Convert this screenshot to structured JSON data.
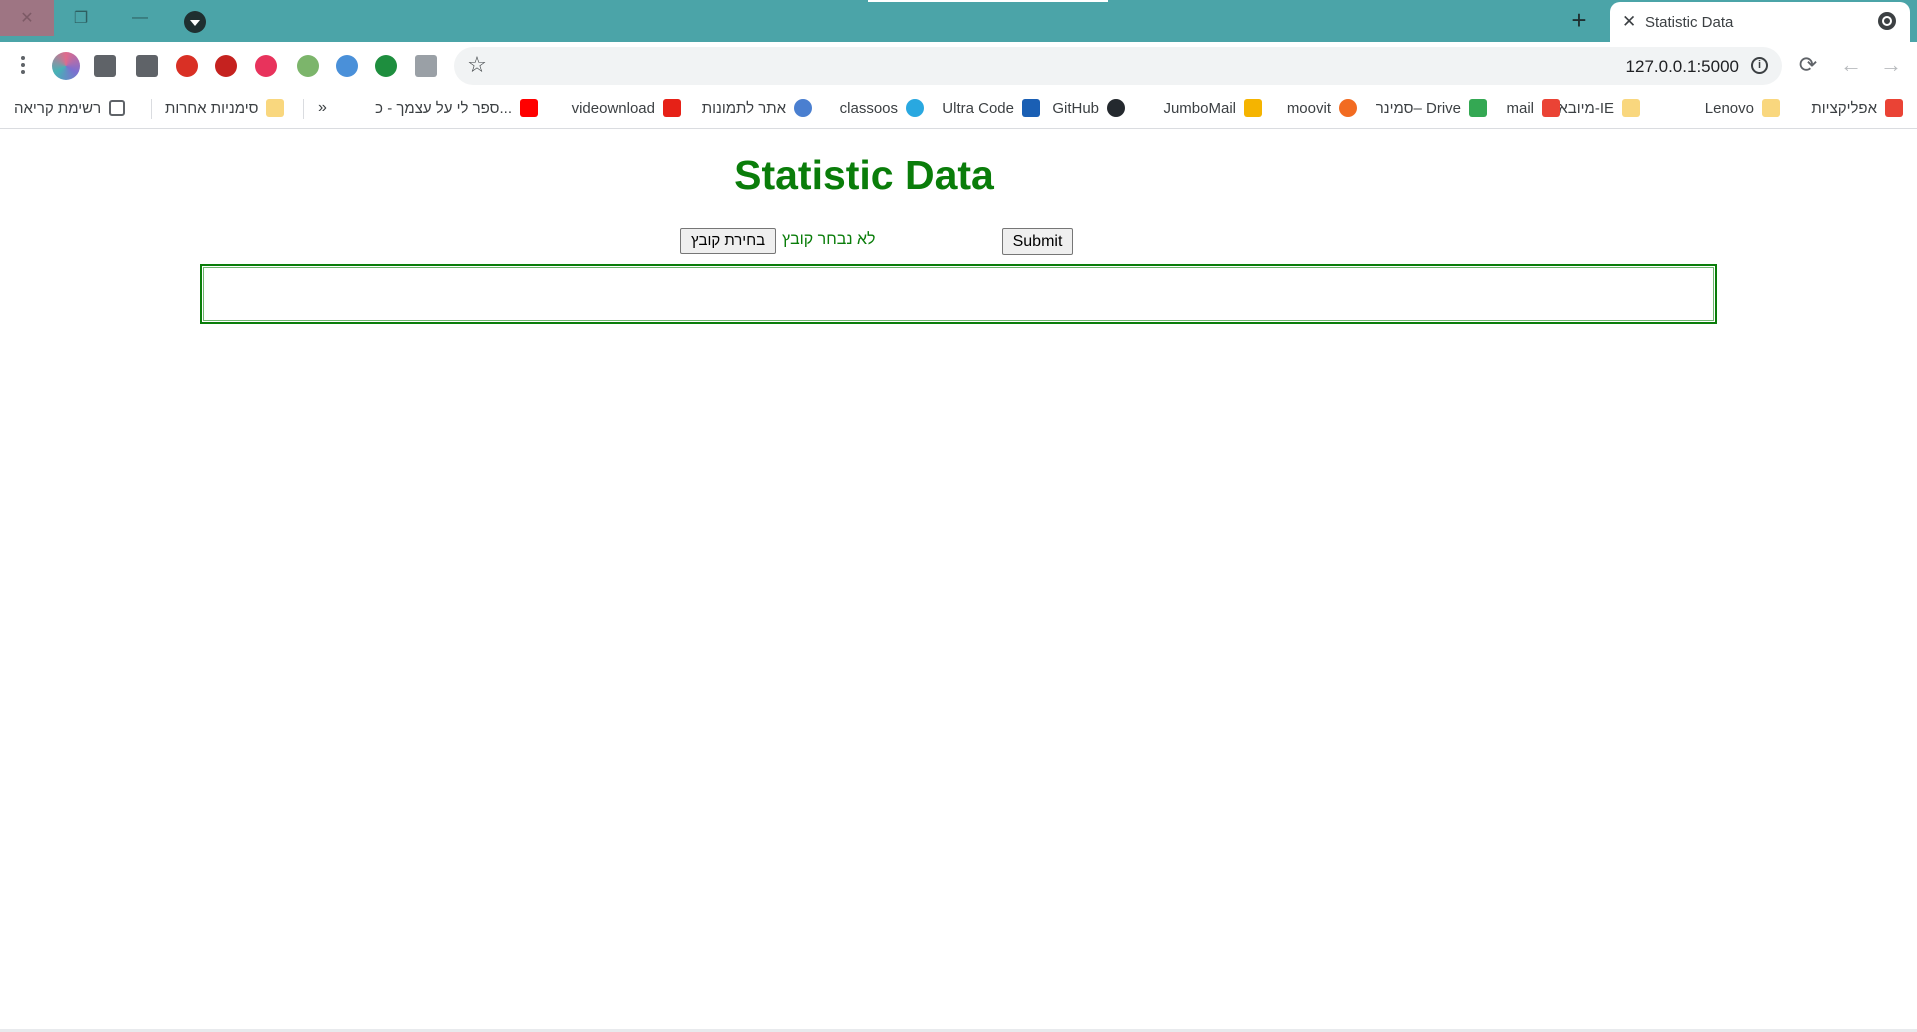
{
  "window": {
    "close_glyph": "✕",
    "restore_glyph": "❐",
    "minimize_glyph": "—"
  },
  "tabs": {
    "new_tab_glyph": "+",
    "active": {
      "title": "Statistic Data",
      "close_glyph": "✕"
    }
  },
  "toolbar": {
    "url": "127.0.0.1:5000",
    "info_glyph": "i",
    "star_glyph": "☆",
    "reload_glyph": "⟳",
    "back_glyph": "←",
    "forward_glyph": "→",
    "extension_icons": [
      {
        "name": "playlist-icon",
        "color": "#5f6368"
      },
      {
        "name": "puzzle-extensions-icon",
        "color": "#5f6368"
      },
      {
        "name": "red-bolt-extension-icon",
        "color": "#d93025"
      },
      {
        "name": "red-badge-extension-icon",
        "color": "#c5221f"
      },
      {
        "name": "pink-at-extension-icon",
        "color": "#e8335c"
      },
      {
        "name": "green-mail-extension-icon",
        "color": "#7cb56b"
      },
      {
        "name": "blue-image-extension-icon",
        "color": "#4a90d9"
      },
      {
        "name": "green-s-extension-icon",
        "color": "#1e8e3e"
      },
      {
        "name": "grey-card-extension-icon",
        "color": "#9aa0a6"
      }
    ]
  },
  "bookmarks": {
    "items": [
      {
        "label": "אפליקציות",
        "icon": "apps-grid-icon",
        "color": "#ea4335"
      },
      {
        "label": "Lenovo",
        "icon": "folder-icon",
        "color": "#f9d77e"
      },
      {
        "label": "מיובא מ-IE",
        "icon": "folder-icon",
        "color": "#f9d77e"
      },
      {
        "label": "mail",
        "icon": "gmail-icon",
        "color": "#ea4335"
      },
      {
        "label": "סמינר– Drive",
        "icon": "google-drive-icon",
        "color": "#34a853"
      },
      {
        "label": "moovit",
        "icon": "moovit-icon",
        "color": "#f26b21"
      },
      {
        "label": "JumboMail",
        "icon": "jumbomail-icon",
        "color": "#f5b400"
      },
      {
        "label": "GitHub",
        "icon": "github-icon",
        "color": "#24292e"
      },
      {
        "label": "Ultra Code",
        "icon": "ultra-code-icon",
        "color": "#1a5fb4"
      },
      {
        "label": "classoos",
        "icon": "classoos-icon",
        "color": "#29a8e0"
      },
      {
        "label": "אתר לתמונות",
        "icon": "photo-site-icon",
        "color": "#4a7fd0"
      },
      {
        "label": "videownload",
        "icon": "youtube-icon",
        "color": "#e62117"
      },
      {
        "label": "ספר לי על עצמך - כ...",
        "icon": "youtube-icon",
        "color": "#ff0000"
      }
    ],
    "overflow_glyph": "»",
    "other_bookmarks": "סימניות אחרות",
    "reading_list": "רשימת קריאה"
  },
  "page": {
    "title": "Statistic Data",
    "file_button": "בחירת קובץ",
    "file_status": "לא נבחר קובץ",
    "submit": "Submit",
    "accent": "#0a7d0a"
  }
}
